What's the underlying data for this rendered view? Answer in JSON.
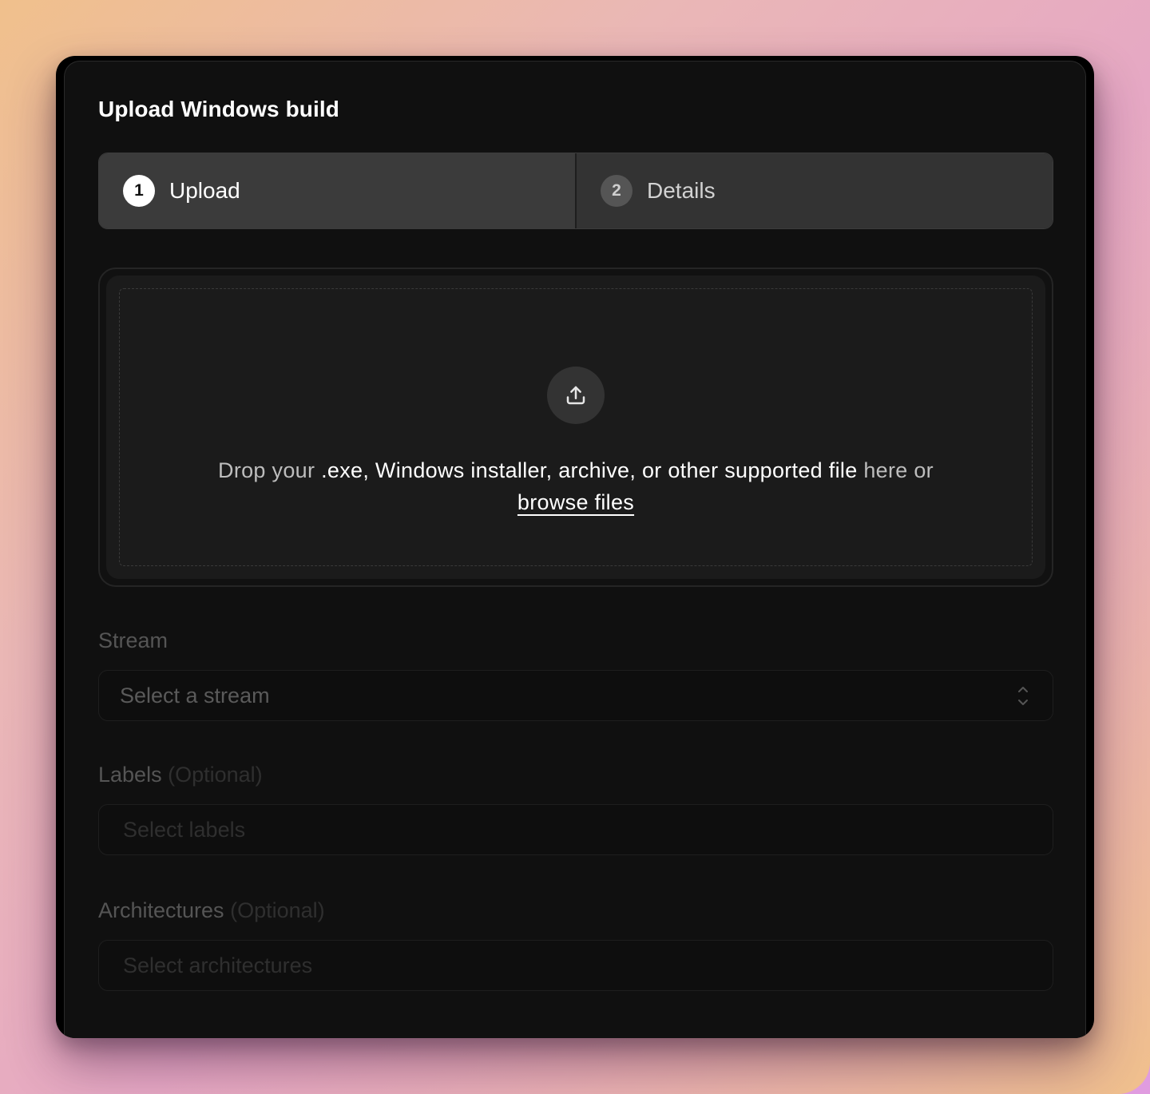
{
  "dialog": {
    "title": "Upload Windows build"
  },
  "steps": [
    {
      "number": "1",
      "label": "Upload",
      "active": true
    },
    {
      "number": "2",
      "label": "Details",
      "active": false
    }
  ],
  "dropzone": {
    "icon": "upload-icon",
    "text_prefix": "Drop your ",
    "text_emphasis": ".exe, Windows installer, archive, or other supported file",
    "text_suffix": " here or",
    "browse_label": "browse files"
  },
  "fields": {
    "stream": {
      "label": "Stream",
      "placeholder": "Select a stream",
      "icon": "chevron-up-down-icon"
    },
    "labels": {
      "label": "Labels",
      "optional": "(Optional)",
      "placeholder": "Select labels"
    },
    "architectures": {
      "label": "Architectures",
      "optional": "(Optional)",
      "placeholder": "Select architectures"
    }
  },
  "colors": {
    "background_gradient": [
      "#f0c08c",
      "#e6a8c4",
      "#e09ce0"
    ],
    "panel": "#101010",
    "active_step": "#3b3b3b"
  }
}
